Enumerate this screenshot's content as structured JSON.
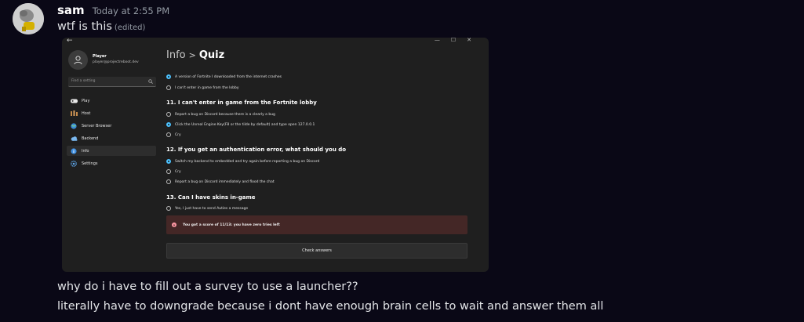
{
  "message": {
    "username": "sam",
    "timestamp": "Today at 2:55 PM",
    "first_line": "wtf is this",
    "edited_tag": "(edited)",
    "line_2": "why do i have to fill out a survey to use a launcher??",
    "line_3": "literally have to downgrade because i dont have enough brain cells to wait and answer them all"
  },
  "embed": {
    "profile": {
      "name": "Player",
      "email": "player@projectreboot.dev"
    },
    "search_placeholder": "Find a setting",
    "nav": [
      {
        "label": "Play",
        "icon": "gamepad-icon"
      },
      {
        "label": "Host",
        "icon": "host-icon"
      },
      {
        "label": "Server Browser",
        "icon": "globe-icon"
      },
      {
        "label": "Backend",
        "icon": "cloud-icon"
      },
      {
        "label": "Info",
        "icon": "info-icon",
        "active": true
      },
      {
        "label": "Settings",
        "icon": "settings-icon"
      }
    ],
    "breadcrumb": {
      "parent": "Info",
      "separator": ">",
      "current": "Quiz"
    },
    "q10_options": [
      {
        "label": "A version of Fortnite I downloaded from the internet crashes",
        "checked": true
      },
      {
        "label": "I can't enter in game from the lobby",
        "checked": false
      }
    ],
    "q11": {
      "title": "11. I can't enter in game from the Fortnite lobby",
      "options": [
        {
          "label": "Report a bug on Discord because there is a clearly a bug",
          "checked": false
        },
        {
          "label": "Click the Unreal Engine Key(F8 or the tilde by default) and type open 127.0.0.1",
          "checked": true
        },
        {
          "label": "Cry",
          "checked": false
        }
      ]
    },
    "q12": {
      "title": "12. If you get an authentication error, what should you do",
      "options": [
        {
          "label": "Switch my backend to embedded and try again before reporting a bug on Discord",
          "checked": true
        },
        {
          "label": "Cry",
          "checked": false
        },
        {
          "label": "Report a bug on Discord immediately and flood the chat",
          "checked": false
        }
      ]
    },
    "q13": {
      "title": "13. Can I have skins in-game",
      "options": [
        {
          "label": "Yes, I just have to send Auties a message",
          "checked": false
        }
      ]
    },
    "result": "You got a score of 11/13: you have zero tries left",
    "check_button": "Check answers",
    "colors": {
      "accent": "#4cc2ff",
      "error_bg": "#442726",
      "error_icon": "#ff99a4"
    }
  }
}
